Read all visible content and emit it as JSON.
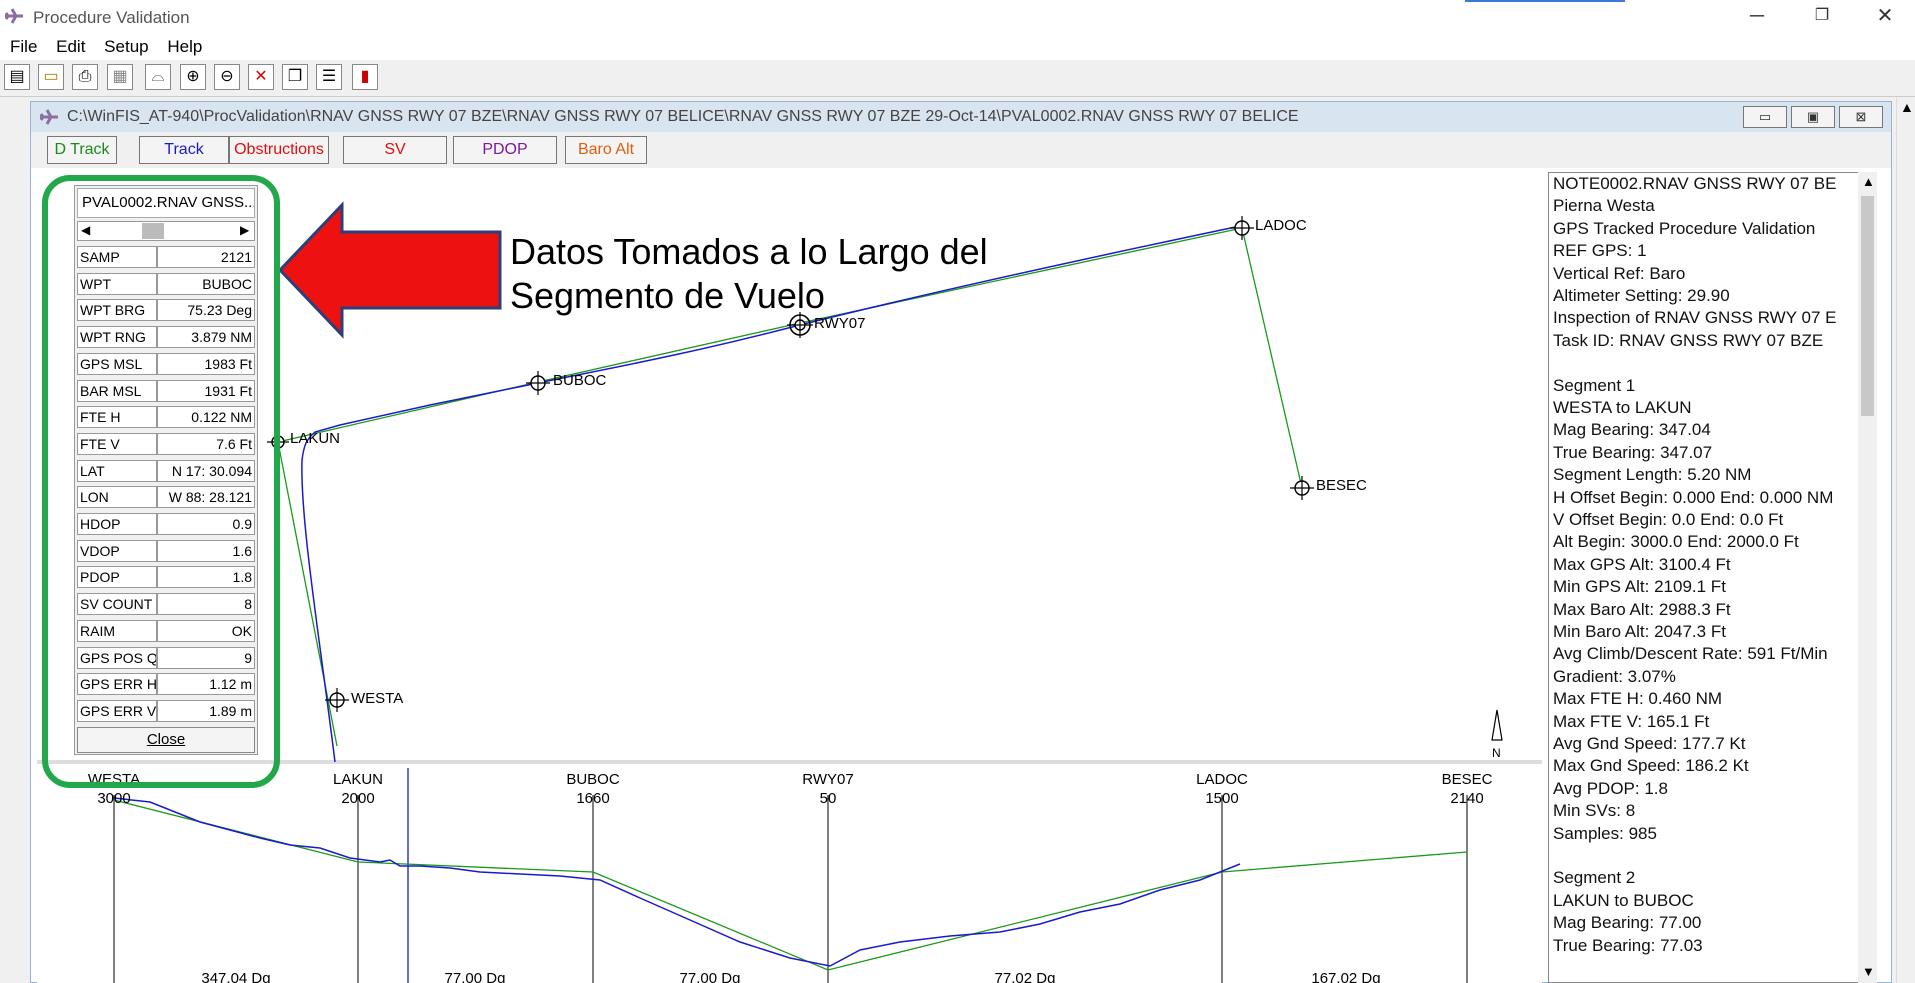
{
  "window": {
    "title": "Procedure Validation",
    "minimize": "─",
    "restore": "❐",
    "close": "✕"
  },
  "menu": [
    "File",
    "Edit",
    "Setup",
    "Help"
  ],
  "toolbar_icons": [
    "new-icon",
    "open-icon",
    "print-icon",
    "preview-icon",
    "profile-icon",
    "zoom-in-icon",
    "zoom-out-icon",
    "zoom-reset-icon",
    "window-cascade-icon",
    "window-tile-icon",
    "exit-icon"
  ],
  "child": {
    "title": "C:\\WinFIS_AT-940\\ProcValidation\\RNAV GNSS RWY 07 BZE\\RNAV GNSS RWY 07 BELICE\\RNAV GNSS RWY 07 BZE 29-Oct-14\\PVAL0002.RNAV GNSS RWY 07 BELICE"
  },
  "tabs": [
    {
      "label": "D Track",
      "color": "#1a8a1a"
    },
    {
      "label": "Track",
      "color": "#1a1acc"
    },
    {
      "label": "Obstructions",
      "color": "#e01010"
    },
    {
      "label": "SV",
      "color": "#e01010"
    },
    {
      "label": "PDOP",
      "color": "#7a1a9a"
    },
    {
      "label": "Baro Alt",
      "color": "#e06010"
    }
  ],
  "panel": {
    "title": "PVAL0002.RNAV GNSS...",
    "rows": [
      {
        "key": "SAMP",
        "value": "2121"
      },
      {
        "key": "WPT",
        "value": "BUBOC"
      },
      {
        "key": "WPT BRG",
        "value": "75.23 Deg"
      },
      {
        "key": "WPT RNG",
        "value": "3.879 NM"
      },
      {
        "key": "GPS MSL",
        "value": "1983  Ft"
      },
      {
        "key": "BAR MSL",
        "value": "1931  Ft"
      },
      {
        "key": "FTE H",
        "value": "0.122 NM"
      },
      {
        "key": "FTE V",
        "value": "7.6 Ft"
      },
      {
        "key": "LAT",
        "value": "N 17: 30.094"
      },
      {
        "key": "LON",
        "value": "W 88: 28.121"
      },
      {
        "key": "HDOP",
        "value": "0.9"
      },
      {
        "key": "VDOP",
        "value": "1.6"
      },
      {
        "key": "PDOP",
        "value": "1.8"
      },
      {
        "key": "SV COUNT",
        "value": "8"
      },
      {
        "key": "RAIM",
        "value": "OK"
      },
      {
        "key": "GPS POS Q",
        "value": "9"
      },
      {
        "key": "GPS ERR H",
        "value": "1.12   m"
      },
      {
        "key": "GPS ERR V",
        "value": "1.89   m"
      }
    ],
    "close_label": "Close"
  },
  "annotation": {
    "line1": "Datos Tomados a lo Largo del",
    "line2": "Segmento  de Vuelo",
    "arrow_color": "#ee1111"
  },
  "map": {
    "waypoints": [
      "LADOC",
      "RWY07",
      "BUBOC",
      "LAKUN",
      "BESEC",
      "WESTA"
    ],
    "north_label": "N"
  },
  "profile": {
    "stations": [
      {
        "name": "WESTA",
        "alt": "3000"
      },
      {
        "name": "LAKUN",
        "alt": "2000"
      },
      {
        "name": "BUBOC",
        "alt": "1660"
      },
      {
        "name": "RWY07",
        "alt": "50"
      },
      {
        "name": "LADOC",
        "alt": "1500"
      },
      {
        "name": "BESEC",
        "alt": "2140"
      }
    ],
    "bearings": [
      "347.04 Dg",
      "77.00 Dg",
      "77.00 Dg",
      "77.02 Dg",
      "167.02 Dg"
    ]
  },
  "notes": [
    "NOTE0002.RNAV GNSS RWY 07 BE",
    "Pierna Westa",
    "GPS Tracked Procedure Validation",
    "REF GPS: 1",
    "Vertical Ref: Baro",
    "Altimeter Setting: 29.90",
    "Inspection of RNAV GNSS RWY 07 E",
    "Task ID: RNAV GNSS RWY 07 BZE",
    "",
    "Segment 1",
    "WESTA to LAKUN",
    "Mag Bearing: 347.04",
    "True Bearing: 347.07",
    "Segment Length: 5.20 NM",
    "H Offset Begin: 0.000 End: 0.000 NM",
    "V Offset Begin: 0.0 End: 0.0 Ft",
    "Alt Begin: 3000.0 End: 2000.0 Ft",
    "Max GPS Alt: 3100.4 Ft",
    "Min GPS Alt: 2109.1 Ft",
    "Max Baro Alt: 2988.3 Ft",
    "Min Baro Alt: 2047.3 Ft",
    "Avg Climb/Descent Rate: 591 Ft/Min",
    "Gradient: 3.07%",
    "Max FTE H: 0.460 NM",
    "Max FTE V: 165.1 Ft",
    "Avg Gnd Speed: 177.7 Kt",
    "Max Gnd Speed: 186.2 Kt",
    "Avg PDOP: 1.8",
    "Min SVs: 8",
    "Samples: 985",
    "",
    "Segment 2",
    "LAKUN to BUBOC",
    "Mag Bearing: 77.00",
    "True Bearing: 77.03"
  ]
}
